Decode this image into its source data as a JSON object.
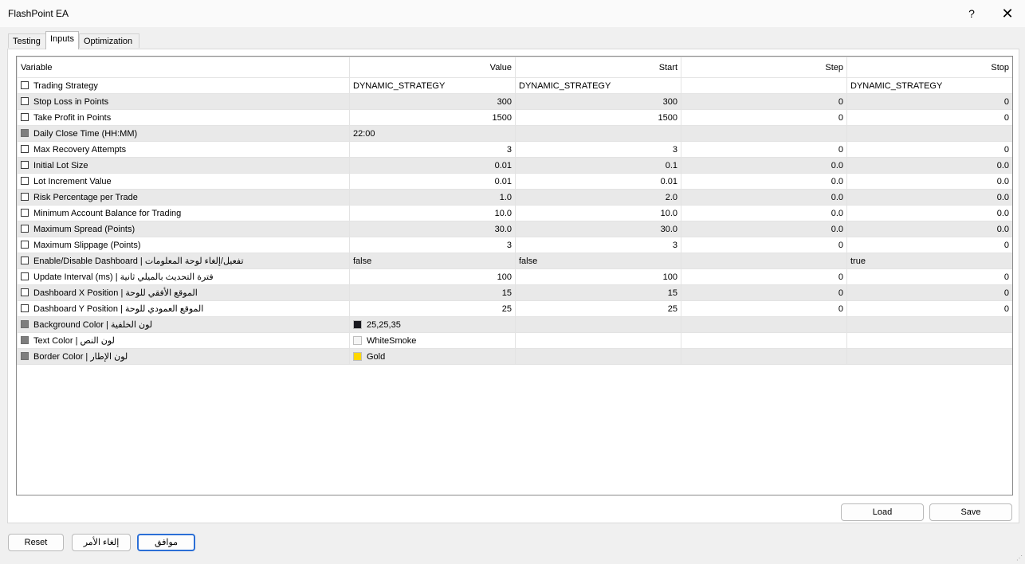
{
  "window": {
    "title": "FlashPoint EA",
    "help": "?",
    "close": "✕"
  },
  "tabs": [
    {
      "label": "Testing"
    },
    {
      "label": "Inputs"
    },
    {
      "label": "Optimization"
    }
  ],
  "columns": {
    "variable": "Variable",
    "value": "Value",
    "start": "Start",
    "step": "Step",
    "stop": "Stop"
  },
  "rows": [
    {
      "name": "Trading Strategy",
      "value": "DYNAMIC_STRATEGY",
      "start": "DYNAMIC_STRATEGY",
      "step": "",
      "stop": "DYNAMIC_STRATEGY"
    },
    {
      "name": "Stop Loss in Points",
      "value": "300",
      "start": "300",
      "step": "0",
      "stop": "0"
    },
    {
      "name": "Take Profit in Points",
      "value": "1500",
      "start": "1500",
      "step": "0",
      "stop": "0"
    },
    {
      "name": "Daily Close Time (HH:MM)",
      "value": "22:00",
      "start": "",
      "step": "",
      "stop": ""
    },
    {
      "name": "Max Recovery Attempts",
      "value": "3",
      "start": "3",
      "step": "0",
      "stop": "0"
    },
    {
      "name": "Initial Lot Size",
      "value": "0.01",
      "start": "0.1",
      "step": "0.0",
      "stop": "0.0"
    },
    {
      "name": "Lot Increment Value",
      "value": "0.01",
      "start": "0.01",
      "step": "0.0",
      "stop": "0.0"
    },
    {
      "name": "Risk Percentage per Trade",
      "value": "1.0",
      "start": "2.0",
      "step": "0.0",
      "stop": "0.0"
    },
    {
      "name": "Minimum Account Balance for Trading",
      "value": "10.0",
      "start": "10.0",
      "step": "0.0",
      "stop": "0.0"
    },
    {
      "name": "Maximum Spread (Points)",
      "value": "30.0",
      "start": "30.0",
      "step": "0.0",
      "stop": "0.0"
    },
    {
      "name": "Maximum Slippage (Points)",
      "value": "3",
      "start": "3",
      "step": "0",
      "stop": "0"
    },
    {
      "name": "Enable/Disable Dashboard | تفعيل/إلغاء لوحة المعلومات",
      "value": "false",
      "start": "false",
      "step": "",
      "stop": "true"
    },
    {
      "name": "Update Interval (ms) | فترة التحديث بالميلي ثانية",
      "value": "100",
      "start": "100",
      "step": "0",
      "stop": "0"
    },
    {
      "name": "Dashboard X Position | الموقع الأفقي للوحة",
      "value": "15",
      "start": "15",
      "step": "0",
      "stop": "0"
    },
    {
      "name": "Dashboard Y Position | الموقع العمودي للوحة",
      "value": "25",
      "start": "25",
      "step": "0",
      "stop": "0"
    },
    {
      "name": "Background Color | لون الخلفية",
      "value": "25,25,35",
      "swatch": "#19191f",
      "start": "",
      "step": "",
      "stop": ""
    },
    {
      "name": "Text Color | لون النص",
      "value": "WhiteSmoke",
      "swatch": "#f5f5f5",
      "start": "",
      "step": "",
      "stop": ""
    },
    {
      "name": "Border Color | لون الإطار",
      "value": "Gold",
      "swatch": "#ffd700",
      "start": "",
      "step": "",
      "stop": ""
    }
  ],
  "buttons": {
    "load": "Load",
    "save": "Save",
    "reset": "Reset",
    "cancel": "إلغاء الأمر",
    "ok": "موافق"
  }
}
